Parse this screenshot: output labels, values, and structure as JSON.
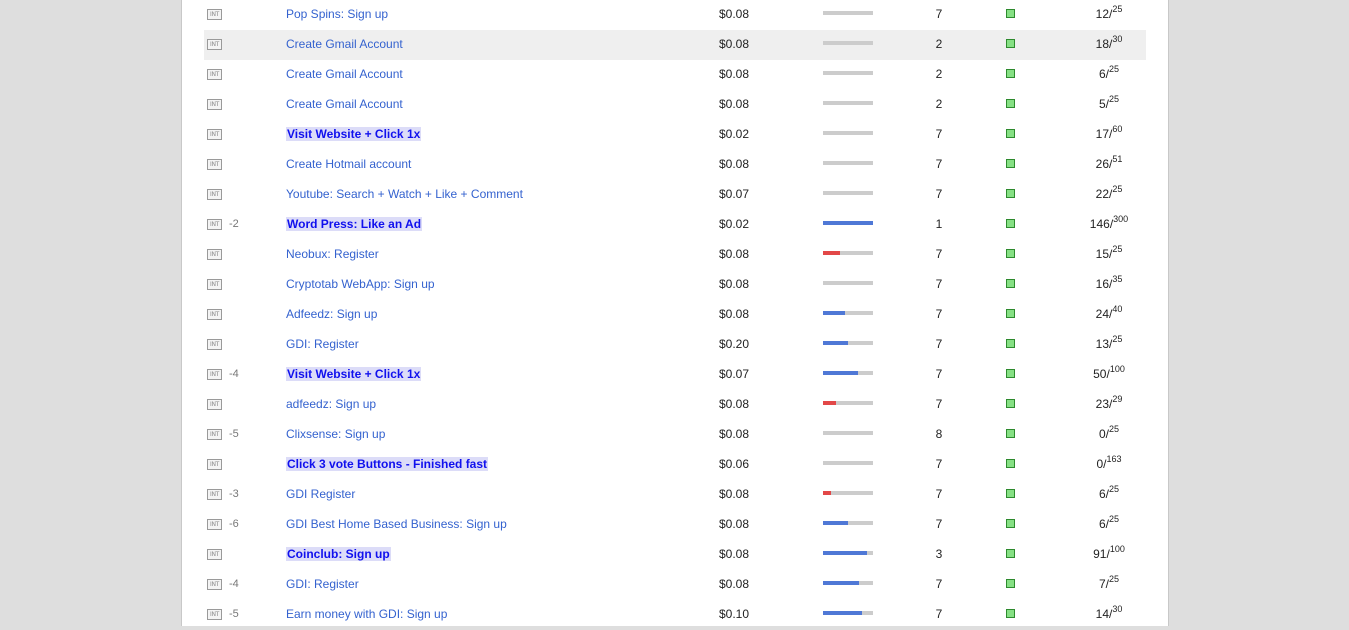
{
  "colors": {
    "bar_blue": "#4f78d6",
    "bar_red": "#e24848",
    "bar_bg": "#cccccc",
    "status_green": "#86e084"
  },
  "rows": [
    {
      "badge": "INT",
      "num": "",
      "title": "Pop Spins: Sign up",
      "bold": false,
      "price": "$0.08",
      "progress": 0,
      "progress_color": "blue",
      "count": "7",
      "done": "12",
      "total": "25",
      "highlight": false
    },
    {
      "badge": "INT",
      "num": "",
      "title": "Create Gmail Account",
      "bold": false,
      "price": "$0.08",
      "progress": 0,
      "progress_color": "blue",
      "count": "2",
      "done": "18",
      "total": "30",
      "highlight": true
    },
    {
      "badge": "INT",
      "num": "",
      "title": "Create Gmail Account",
      "bold": false,
      "price": "$0.08",
      "progress": 0,
      "progress_color": "blue",
      "count": "2",
      "done": "6",
      "total": "25",
      "highlight": false
    },
    {
      "badge": "INT",
      "num": "",
      "title": "Create Gmail Account",
      "bold": false,
      "price": "$0.08",
      "progress": 0,
      "progress_color": "blue",
      "count": "2",
      "done": "5",
      "total": "25",
      "highlight": false
    },
    {
      "badge": "INT",
      "num": "",
      "title": "Visit Website + Click 1x",
      "bold": true,
      "price": "$0.02",
      "progress": 0,
      "progress_color": "blue",
      "count": "7",
      "done": "17",
      "total": "60",
      "highlight": false
    },
    {
      "badge": "INT",
      "num": "",
      "title": "Create Hotmail account",
      "bold": false,
      "price": "$0.08",
      "progress": 0,
      "progress_color": "blue",
      "count": "7",
      "done": "26",
      "total": "51",
      "highlight": false
    },
    {
      "badge": "INT",
      "num": "",
      "title": "Youtube: Search + Watch + Like + Comment",
      "bold": false,
      "price": "$0.07",
      "progress": 0,
      "progress_color": "blue",
      "count": "7",
      "done": "22",
      "total": "25",
      "highlight": false
    },
    {
      "badge": "INT",
      "num": "-2",
      "title": "Word Press: Like an Ad",
      "bold": true,
      "price": "$0.02",
      "progress": 1.0,
      "progress_color": "blue",
      "count": "1",
      "done": "146",
      "total": "300",
      "highlight": false
    },
    {
      "badge": "INT",
      "num": "",
      "title": "Neobux: Register",
      "bold": false,
      "price": "$0.08",
      "progress": 0.34,
      "progress_color": "red",
      "count": "7",
      "done": "15",
      "total": "25",
      "highlight": false
    },
    {
      "badge": "INT",
      "num": "",
      "title": "Cryptotab WebApp: Sign up",
      "bold": false,
      "price": "$0.08",
      "progress": 0,
      "progress_color": "blue",
      "count": "7",
      "done": "16",
      "total": "35",
      "highlight": false
    },
    {
      "badge": "INT",
      "num": "",
      "title": "Adfeedz: Sign up",
      "bold": false,
      "price": "$0.08",
      "progress": 0.44,
      "progress_color": "blue",
      "count": "7",
      "done": "24",
      "total": "40",
      "highlight": false
    },
    {
      "badge": "INT",
      "num": "",
      "title": "GDI: Register",
      "bold": false,
      "price": "$0.20",
      "progress": 0.5,
      "progress_color": "blue",
      "count": "7",
      "done": "13",
      "total": "25",
      "highlight": false
    },
    {
      "badge": "INT",
      "num": "-4",
      "title": "Visit Website + Click 1x",
      "bold": true,
      "price": "$0.07",
      "progress": 0.7,
      "progress_color": "blue",
      "count": "7",
      "done": "50",
      "total": "100",
      "highlight": false
    },
    {
      "badge": "INT",
      "num": "",
      "title": "adfeedz: Sign up",
      "bold": false,
      "price": "$0.08",
      "progress": 0.26,
      "progress_color": "red",
      "count": "7",
      "done": "23",
      "total": "29",
      "highlight": false
    },
    {
      "badge": "INT",
      "num": "-5",
      "title": "Clixsense: Sign up",
      "bold": false,
      "price": "$0.08",
      "progress": 0,
      "progress_color": "blue",
      "count": "8",
      "done": "0",
      "total": "25",
      "highlight": false
    },
    {
      "badge": "INT",
      "num": "",
      "title": "Click 3 vote Buttons - Finished fast",
      "bold": true,
      "price": "$0.06",
      "progress": 0,
      "progress_color": "blue",
      "count": "7",
      "done": "0",
      "total": "163",
      "highlight": false
    },
    {
      "badge": "INT",
      "num": "-3",
      "title": "GDI Register",
      "bold": false,
      "price": "$0.08",
      "progress": 0.16,
      "progress_color": "red",
      "count": "7",
      "done": "6",
      "total": "25",
      "highlight": false
    },
    {
      "badge": "INT",
      "num": "-6",
      "title": "GDI Best Home Based Business: Sign up",
      "bold": false,
      "price": "$0.08",
      "progress": 0.5,
      "progress_color": "blue",
      "count": "7",
      "done": "6",
      "total": "25",
      "highlight": false
    },
    {
      "badge": "INT",
      "num": "",
      "title": "Coinclub: Sign up",
      "bold": true,
      "price": "$0.08",
      "progress": 0.88,
      "progress_color": "blue",
      "count": "3",
      "done": "91",
      "total": "100",
      "highlight": false
    },
    {
      "badge": "INT",
      "num": "-4",
      "title": "GDI: Register",
      "bold": false,
      "price": "$0.08",
      "progress": 0.72,
      "progress_color": "blue",
      "count": "7",
      "done": "7",
      "total": "25",
      "highlight": false
    },
    {
      "badge": "INT",
      "num": "-5",
      "title": "Earn money with GDI: Sign up",
      "bold": false,
      "price": "$0.10",
      "progress": 0.78,
      "progress_color": "blue",
      "count": "7",
      "done": "14",
      "total": "30",
      "highlight": false
    }
  ]
}
